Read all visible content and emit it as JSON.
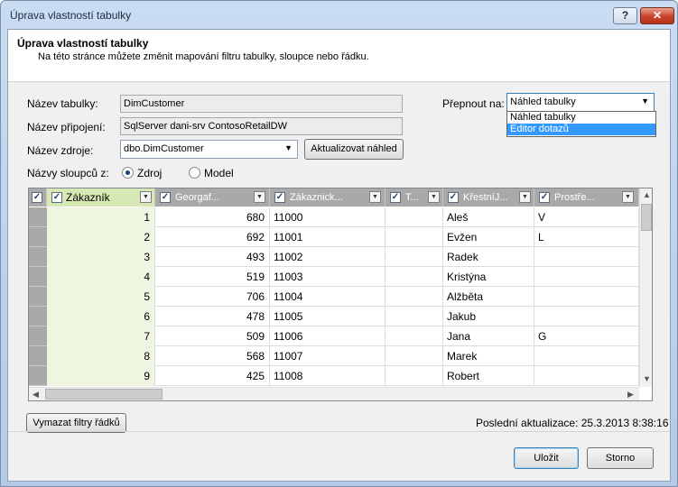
{
  "window": {
    "title": "Úprava vlastností tabulky",
    "help_label": "?",
    "close_label": "✕"
  },
  "header": {
    "title": "Úprava vlastností tabulky",
    "description": "Na této stránce můžete změnit mapování filtru tabulky, sloupce nebo řádku."
  },
  "form": {
    "table_name_label": "Název tabulky:",
    "table_name_value": "DimCustomer",
    "connection_label": "Název připojení:",
    "connection_value": "SqlServer dani-srv ContosoRetailDW",
    "source_label": "Název zdroje:",
    "source_value": "dbo.DimCustomer",
    "refresh_label": "Aktualizovat náhled",
    "colnames_label": "Názvy sloupců z:",
    "radio_source": "Zdroj",
    "radio_model": "Model",
    "radio_selected": "Zdroj",
    "switch_label": "Přepnout na:",
    "switch_value": "Náhled tabulky",
    "switch_options": [
      "Náhled tabulky",
      "Editor dotazů"
    ],
    "switch_highlighted": "Editor dotazů"
  },
  "grid": {
    "columns": [
      "Zákazník",
      "Georgaf...",
      "Zákaznick...",
      "T...",
      "KřestníJ...",
      "Prostře..."
    ],
    "rows": [
      [
        "1",
        "680",
        "11000",
        "",
        "Aleš",
        "V"
      ],
      [
        "2",
        "692",
        "11001",
        "",
        "Evžen",
        "L"
      ],
      [
        "3",
        "493",
        "11002",
        "",
        "Radek",
        ""
      ],
      [
        "4",
        "519",
        "11003",
        "",
        "Kristýna",
        ""
      ],
      [
        "5",
        "706",
        "11004",
        "",
        "Alžběta",
        ""
      ],
      [
        "6",
        "478",
        "11005",
        "",
        "Jakub",
        ""
      ],
      [
        "7",
        "509",
        "11006",
        "",
        "Jana",
        "G"
      ],
      [
        "8",
        "568",
        "11007",
        "",
        "Marek",
        ""
      ],
      [
        "9",
        "425",
        "11008",
        "",
        "Robert",
        ""
      ]
    ]
  },
  "bottom": {
    "clear_filters_label": "Vymazat filtry řádků",
    "last_update": "Poslední aktualizace: 25.3.2013 8:38:16",
    "ok_label": "Uložit",
    "cancel_label": "Storno"
  },
  "colors": {
    "accent": "#3399ff",
    "header_first_col": "#d6e9b4"
  }
}
